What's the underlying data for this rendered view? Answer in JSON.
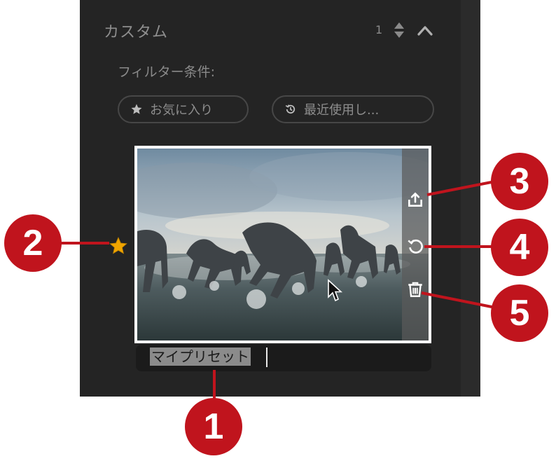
{
  "section": {
    "title": "カスタム",
    "count": "1"
  },
  "filters": {
    "label": "フィルター条件:",
    "favorites": "お気に入り",
    "recent": "最近使用し..."
  },
  "preset": {
    "name": "マイプリセット",
    "favorite": true,
    "actions": [
      "upload-icon",
      "reset-icon",
      "trash-icon"
    ]
  },
  "callouts": [
    "1",
    "2",
    "3",
    "4",
    "5"
  ],
  "colors": {
    "panel": "#242424",
    "callout": "#c0141d",
    "star": "#f0a500"
  }
}
